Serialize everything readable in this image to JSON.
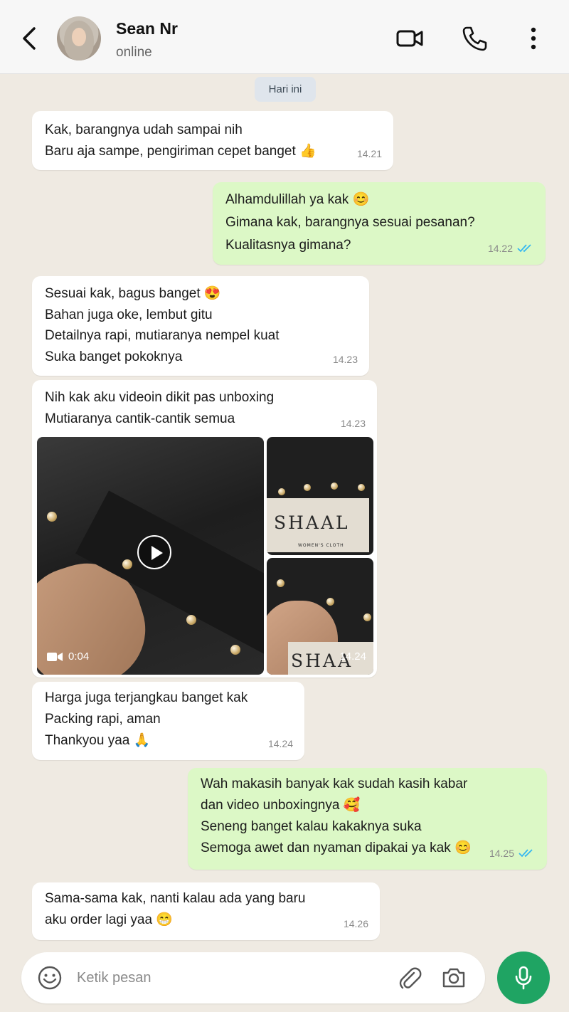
{
  "header": {
    "contact_name": "Sean Nr",
    "status": "online"
  },
  "date_chip": "Hari ini",
  "messages": [
    {
      "direction": "in",
      "lines": [
        "Kak, barangnya udah sampai nih",
        "Baru aja sampe, pengiriman cepet banget 👍"
      ],
      "time": "14.21"
    },
    {
      "direction": "out",
      "lines": [
        "Alhamdulillah ya kak 😊",
        "Gimana kak, barangnya sesuai pesanan?",
        "Kualitasnya gimana?"
      ],
      "time": "14.22",
      "read": true
    },
    {
      "direction": "in",
      "lines": [
        "Sesuai kak, bagus banget 😍",
        "Bahan juga oke, lembut gitu",
        "Detailnya rapi, mutiaranya nempel kuat",
        "Suka banget pokoknya"
      ],
      "time": "14.23"
    },
    {
      "direction": "in",
      "lines": [
        "Nih kak aku videoin dikit pas unboxing",
        "Mutiaranya cantik-cantik semua"
      ],
      "time": "14.23",
      "media": {
        "video_duration": "0:04",
        "time": "14.24",
        "brand_text": "SHAAL",
        "brand_sub": "WOMEN'S CLOTH",
        "brand_text_cropped": "SHAA"
      }
    },
    {
      "direction": "in",
      "lines": [
        "Harga juga terjangkau banget kak",
        "Packing rapi, aman",
        "Thankyou yaa 🙏"
      ],
      "time": "14.24"
    },
    {
      "direction": "out",
      "lines": [
        "Wah makasih banyak kak sudah kasih kabar",
        "dan video unboxingnya 🥰",
        "Seneng banget kalau kakaknya suka",
        "Semoga awet dan nyaman dipakai ya kak 😊"
      ],
      "time": "14.25",
      "read": true
    },
    {
      "direction": "in",
      "lines": [
        "Sama-sama kak, nanti kalau ada yang baru",
        "aku order lagi yaa 😁"
      ],
      "time": "14.26"
    }
  ],
  "input": {
    "placeholder": "Ketik pesan"
  },
  "colors": {
    "outgoing_bubble": "#dcf8c6",
    "incoming_bubble": "#ffffff",
    "background": "#efeae2",
    "accent_green": "#1fa463",
    "read_ticks": "#34b7f1"
  },
  "icons": [
    "back-arrow-icon",
    "video-call-icon",
    "phone-icon",
    "more-vertical-icon",
    "play-icon",
    "video-camera-icon",
    "emoji-icon",
    "paperclip-icon",
    "camera-icon",
    "microphone-icon"
  ]
}
